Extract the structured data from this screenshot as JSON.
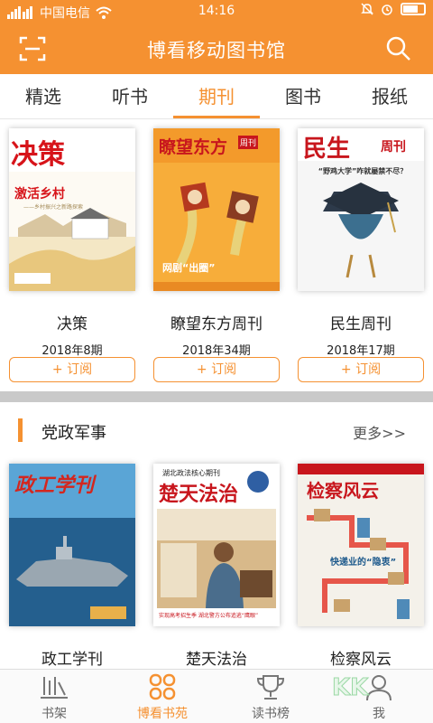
{
  "status_bar": {
    "carrier": "中国电信",
    "time": "14:16"
  },
  "header": {
    "title": "博看移动图书馆"
  },
  "tabs": [
    {
      "label": "精选",
      "active": false
    },
    {
      "label": "听书",
      "active": false
    },
    {
      "label": "期刊",
      "active": true
    },
    {
      "label": "图书",
      "active": false
    },
    {
      "label": "报纸",
      "active": false
    }
  ],
  "featured": [
    {
      "title": "决策",
      "issue": "2018年8期",
      "subscribe_label": "+ 订阅",
      "cover": {
        "masthead": "决策",
        "headline": "激活乡村",
        "tagline": "——乡村振兴之新路探索"
      }
    },
    {
      "title": "瞭望东方周刊",
      "issue": "2018年34期",
      "subscribe_label": "+ 订阅",
      "cover": {
        "masthead": "瞭望东方",
        "masthead2": "周刊",
        "headline": "网剧“出圈”"
      }
    },
    {
      "title": "民生周刊",
      "issue": "2018年17期",
      "subscribe_label": "+ 订阅",
      "cover": {
        "masthead": "民生",
        "masthead2": "周刊",
        "headline": "“野鸡大学”咋就屡禁不尽？"
      }
    }
  ],
  "section": {
    "title": "党政军事",
    "more_label": "更多>>"
  },
  "section_items": [
    {
      "title": "政工学刊",
      "cover": {
        "masthead": "政工学刊"
      }
    },
    {
      "title": "楚天法治",
      "cover": {
        "masthead": "楚天法治",
        "kicker": "湖北政法核心期刊",
        "bottom": "实现高考招生季 湖北警方公布追逃“鹰眼”"
      }
    },
    {
      "title": "检察风云",
      "cover": {
        "masthead": "检察风云",
        "headline": "快递业的“隐衷”"
      }
    }
  ],
  "bottom_nav": [
    {
      "label": "书架",
      "icon": "bookshelf-icon",
      "active": false
    },
    {
      "label": "博看书苑",
      "icon": "flower-icon",
      "active": true
    },
    {
      "label": "读书榜",
      "icon": "trophy-icon",
      "active": false
    },
    {
      "label": "我",
      "icon": "user-icon",
      "active": false
    }
  ],
  "watermark": {
    "text": "KK"
  },
  "colors": {
    "accent": "#f59131"
  }
}
